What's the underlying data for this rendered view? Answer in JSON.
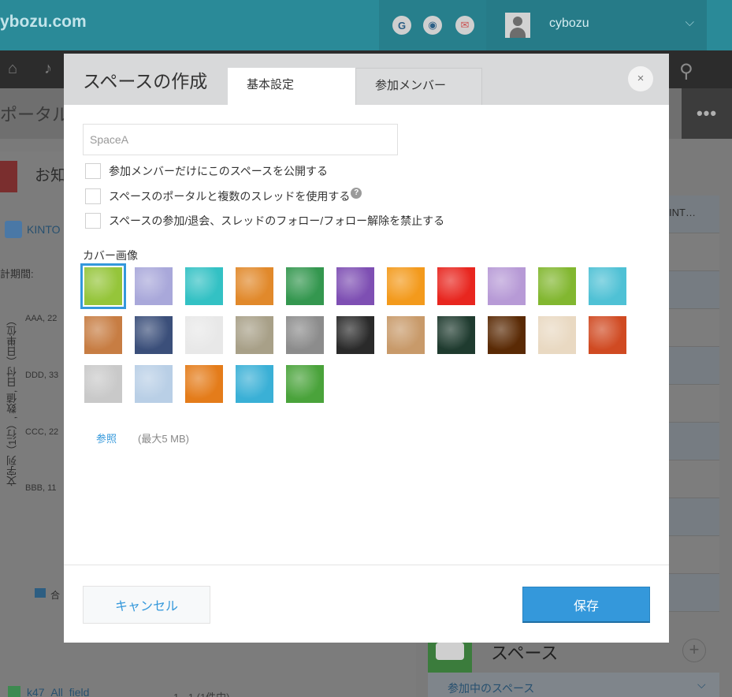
{
  "background": {
    "logo_text": "ybozu.com",
    "header_icons": [
      "G",
      "◉",
      "✉"
    ],
    "user_name": "cybozu",
    "portal_title": "ポータル",
    "notice_label": "お知",
    "kintone_label": "KINTO",
    "period_label": "計期間:",
    "chart_rows": [
      "AAA, 22",
      "DDD, 33",
      "CCC, 22",
      "BBB, 11"
    ],
    "vertical_axis": "文字列（1行）, 数値, 日付（日単位）",
    "legend_label": "合",
    "app_link": "k47_All_field",
    "pager": "1 - 1 (1件中)",
    "right_column_header": "INT…",
    "space_panel_title": "スペース",
    "space_panel_sub": "参加中のスペース"
  },
  "modal": {
    "title": "スペースの作成",
    "tabs": [
      "基本設定",
      "参加メンバー"
    ],
    "close": "×",
    "space_name_value": "SpaceA",
    "options": [
      "参加メンバーだけにこのスペースを公開する",
      "スペースのポータルと複数のスレッドを使用する",
      "スペースの参加/退会、スレッドのフォロー/フォロー解除を禁止する"
    ],
    "help_icon": "?",
    "cover_label": "カバー画像",
    "cover_images": [
      {
        "name": "lime-green",
        "bg": "#95c53a"
      },
      {
        "name": "lavender-gradient",
        "bg": "#a9a8da"
      },
      {
        "name": "turquoise-water",
        "bg": "#33c1c4"
      },
      {
        "name": "orange-texture",
        "bg": "#e1892b"
      },
      {
        "name": "green-grass",
        "bg": "#34974f"
      },
      {
        "name": "purple-texture",
        "bg": "#7e4fb3"
      },
      {
        "name": "orange-flowers",
        "bg": "#f39a1c"
      },
      {
        "name": "red-carnation",
        "bg": "#e8261f"
      },
      {
        "name": "purple-flowers",
        "bg": "#b79ad6"
      },
      {
        "name": "leaf-dew",
        "bg": "#82b730"
      },
      {
        "name": "white-cubes",
        "bg": "#4fc1d5"
      },
      {
        "name": "woven-basket",
        "bg": "#c77d43"
      },
      {
        "name": "mosaic-tiles",
        "bg": "#3b4f7a"
      },
      {
        "name": "compass",
        "bg": "#e8e8e8"
      },
      {
        "name": "stacked-books",
        "bg": "#a8a088"
      },
      {
        "name": "gears",
        "bg": "#8c8c8c"
      },
      {
        "name": "chalkboard-shapes",
        "bg": "#2a2a2a"
      },
      {
        "name": "colored-pencils",
        "bg": "#c89a6a"
      },
      {
        "name": "lightbulb-board",
        "bg": "#1f3b2f"
      },
      {
        "name": "bokeh",
        "bg": "#5a2a05"
      },
      {
        "name": "latte-art",
        "bg": "#e9d9c2"
      },
      {
        "name": "vegetables",
        "bg": "#d04a22"
      },
      {
        "name": "cat",
        "bg": "#c9c9c9"
      },
      {
        "name": "winter-trees",
        "bg": "#b9cfe6"
      },
      {
        "name": "pumpkins",
        "bg": "#e47c1a"
      },
      {
        "name": "palm-beach",
        "bg": "#3ab0d6"
      },
      {
        "name": "bamboo",
        "bg": "#4aa33b"
      }
    ],
    "browse_label": "参照",
    "max_size": "(最大5 MB)",
    "cancel_label": "キャンセル",
    "save_label": "保存"
  }
}
